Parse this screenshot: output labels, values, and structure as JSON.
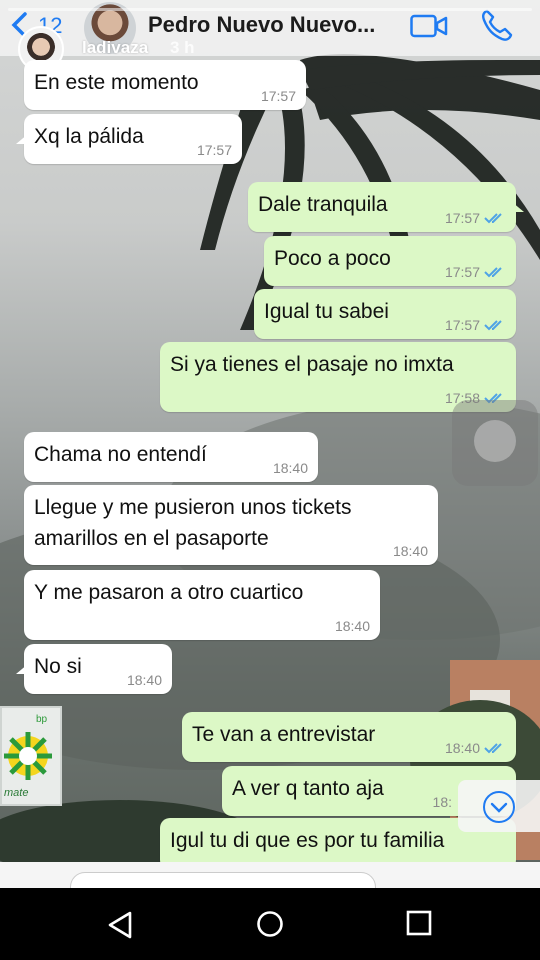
{
  "header": {
    "back_count": "12",
    "contact_name": "Pedro Nuevo Nuevo..."
  },
  "story": {
    "username": "ladivaza",
    "time_ago": "3 h"
  },
  "messages": [
    {
      "dir": "in",
      "text": "En este momento",
      "time": "17:57",
      "read": false
    },
    {
      "dir": "in",
      "text": "Xq la pálida",
      "time": "17:57",
      "read": false
    },
    {
      "dir": "out",
      "text": "Dale tranquila",
      "time": "17:57",
      "read": true
    },
    {
      "dir": "out",
      "text": "Poco a poco",
      "time": "17:57",
      "read": true
    },
    {
      "dir": "out",
      "text": "Igual tu sabei",
      "time": "17:57",
      "read": true
    },
    {
      "dir": "out",
      "text": "Si ya tienes el pasaje no imxta",
      "time": "17:58",
      "read": true
    },
    {
      "dir": "in",
      "text": "Chama no entendí",
      "time": "18:40",
      "read": false
    },
    {
      "dir": "in",
      "text_line1": "Llegue y me pusieron unos tickets",
      "text_line2": "amarillos en el pasaporte",
      "time": "18:40",
      "read": false
    },
    {
      "dir": "in",
      "text": "Y me pasaron a otro cuartico",
      "time": "18:40",
      "read": false
    },
    {
      "dir": "in",
      "text": "No si",
      "time": "18:40",
      "read": false
    },
    {
      "dir": "out",
      "text": "Te van a entrevistar",
      "time": "18:40",
      "read": true
    },
    {
      "dir": "out",
      "text": "A ver q tanto aja",
      "time": "18:",
      "read": true
    },
    {
      "dir": "out",
      "text": "Igul tu di que es por tu familia",
      "time": "",
      "read": true
    }
  ],
  "sign": {
    "logo_text": "bp",
    "sub_text": "mate"
  },
  "colors": {
    "incoming_bubble": "#ffffff",
    "outgoing_bubble": "#dcf8c6",
    "tick_read": "#4fa3e6",
    "accent": "#1f7bf2"
  }
}
